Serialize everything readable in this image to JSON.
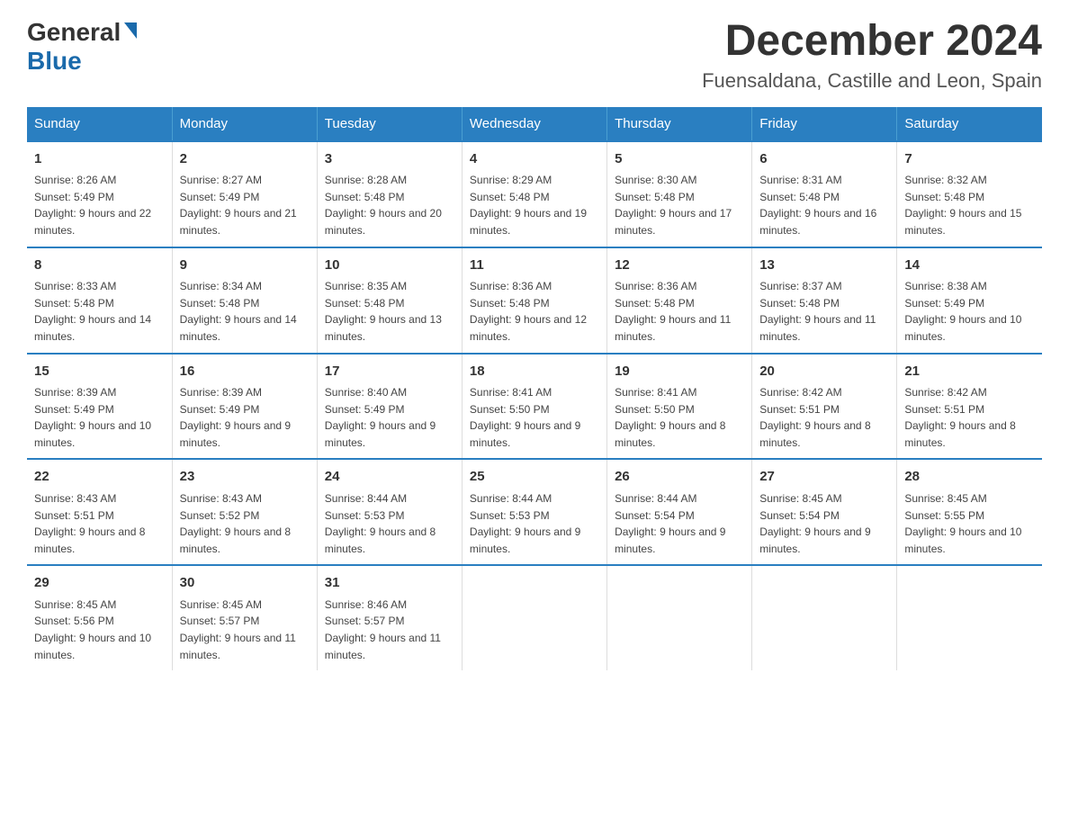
{
  "header": {
    "logo_general": "General",
    "logo_blue": "Blue",
    "month_year": "December 2024",
    "location": "Fuensaldana, Castille and Leon, Spain"
  },
  "days_of_week": [
    "Sunday",
    "Monday",
    "Tuesday",
    "Wednesday",
    "Thursday",
    "Friday",
    "Saturday"
  ],
  "weeks": [
    [
      {
        "day": "1",
        "sunrise": "8:26 AM",
        "sunset": "5:49 PM",
        "daylight": "9 hours and 22 minutes."
      },
      {
        "day": "2",
        "sunrise": "8:27 AM",
        "sunset": "5:49 PM",
        "daylight": "9 hours and 21 minutes."
      },
      {
        "day": "3",
        "sunrise": "8:28 AM",
        "sunset": "5:48 PM",
        "daylight": "9 hours and 20 minutes."
      },
      {
        "day": "4",
        "sunrise": "8:29 AM",
        "sunset": "5:48 PM",
        "daylight": "9 hours and 19 minutes."
      },
      {
        "day": "5",
        "sunrise": "8:30 AM",
        "sunset": "5:48 PM",
        "daylight": "9 hours and 17 minutes."
      },
      {
        "day": "6",
        "sunrise": "8:31 AM",
        "sunset": "5:48 PM",
        "daylight": "9 hours and 16 minutes."
      },
      {
        "day": "7",
        "sunrise": "8:32 AM",
        "sunset": "5:48 PM",
        "daylight": "9 hours and 15 minutes."
      }
    ],
    [
      {
        "day": "8",
        "sunrise": "8:33 AM",
        "sunset": "5:48 PM",
        "daylight": "9 hours and 14 minutes."
      },
      {
        "day": "9",
        "sunrise": "8:34 AM",
        "sunset": "5:48 PM",
        "daylight": "9 hours and 14 minutes."
      },
      {
        "day": "10",
        "sunrise": "8:35 AM",
        "sunset": "5:48 PM",
        "daylight": "9 hours and 13 minutes."
      },
      {
        "day": "11",
        "sunrise": "8:36 AM",
        "sunset": "5:48 PM",
        "daylight": "9 hours and 12 minutes."
      },
      {
        "day": "12",
        "sunrise": "8:36 AM",
        "sunset": "5:48 PM",
        "daylight": "9 hours and 11 minutes."
      },
      {
        "day": "13",
        "sunrise": "8:37 AM",
        "sunset": "5:48 PM",
        "daylight": "9 hours and 11 minutes."
      },
      {
        "day": "14",
        "sunrise": "8:38 AM",
        "sunset": "5:49 PM",
        "daylight": "9 hours and 10 minutes."
      }
    ],
    [
      {
        "day": "15",
        "sunrise": "8:39 AM",
        "sunset": "5:49 PM",
        "daylight": "9 hours and 10 minutes."
      },
      {
        "day": "16",
        "sunrise": "8:39 AM",
        "sunset": "5:49 PM",
        "daylight": "9 hours and 9 minutes."
      },
      {
        "day": "17",
        "sunrise": "8:40 AM",
        "sunset": "5:49 PM",
        "daylight": "9 hours and 9 minutes."
      },
      {
        "day": "18",
        "sunrise": "8:41 AM",
        "sunset": "5:50 PM",
        "daylight": "9 hours and 9 minutes."
      },
      {
        "day": "19",
        "sunrise": "8:41 AM",
        "sunset": "5:50 PM",
        "daylight": "9 hours and 8 minutes."
      },
      {
        "day": "20",
        "sunrise": "8:42 AM",
        "sunset": "5:51 PM",
        "daylight": "9 hours and 8 minutes."
      },
      {
        "day": "21",
        "sunrise": "8:42 AM",
        "sunset": "5:51 PM",
        "daylight": "9 hours and 8 minutes."
      }
    ],
    [
      {
        "day": "22",
        "sunrise": "8:43 AM",
        "sunset": "5:51 PM",
        "daylight": "9 hours and 8 minutes."
      },
      {
        "day": "23",
        "sunrise": "8:43 AM",
        "sunset": "5:52 PM",
        "daylight": "9 hours and 8 minutes."
      },
      {
        "day": "24",
        "sunrise": "8:44 AM",
        "sunset": "5:53 PM",
        "daylight": "9 hours and 8 minutes."
      },
      {
        "day": "25",
        "sunrise": "8:44 AM",
        "sunset": "5:53 PM",
        "daylight": "9 hours and 9 minutes."
      },
      {
        "day": "26",
        "sunrise": "8:44 AM",
        "sunset": "5:54 PM",
        "daylight": "9 hours and 9 minutes."
      },
      {
        "day": "27",
        "sunrise": "8:45 AM",
        "sunset": "5:54 PM",
        "daylight": "9 hours and 9 minutes."
      },
      {
        "day": "28",
        "sunrise": "8:45 AM",
        "sunset": "5:55 PM",
        "daylight": "9 hours and 10 minutes."
      }
    ],
    [
      {
        "day": "29",
        "sunrise": "8:45 AM",
        "sunset": "5:56 PM",
        "daylight": "9 hours and 10 minutes."
      },
      {
        "day": "30",
        "sunrise": "8:45 AM",
        "sunset": "5:57 PM",
        "daylight": "9 hours and 11 minutes."
      },
      {
        "day": "31",
        "sunrise": "8:46 AM",
        "sunset": "5:57 PM",
        "daylight": "9 hours and 11 minutes."
      },
      null,
      null,
      null,
      null
    ]
  ]
}
